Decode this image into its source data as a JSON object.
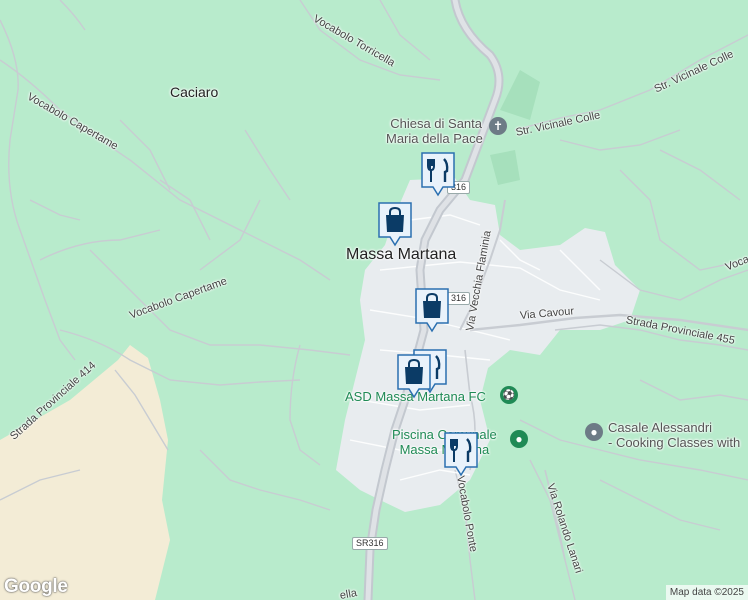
{
  "places": {
    "town": "Massa Martana",
    "hamlet": "Caciaro"
  },
  "roads": {
    "torricella": "Vocabolo Torricella",
    "capertame_1": "Vocabolo Capertame",
    "capertame_2": "Vocabolo Capertame",
    "sp414": "Strada Provinciale 414",
    "vicinale_colle_1": "Str. Vicinale Colle",
    "vicinale_colle_2": "Str. Vicinale Colle",
    "vecchia_flaminia": "Via Vecchia Flaminia",
    "cavour": "Via Cavour",
    "sp455": "Strada Provinciale 455",
    "vocabolo_ponte": "Vocabolo Ponte",
    "rolando_lanari": "Via Rolando Lanari",
    "voca_edge": "Voca",
    "bottom_cut": "ella"
  },
  "badges": {
    "sr316_top": "316",
    "sr316_mid": "316",
    "sr316_bottom": "SR316"
  },
  "pois": {
    "church_line1": "Chiesa di Santa",
    "church_line2": "Maria della Pace",
    "asd": "ASD Massa Martana FC",
    "piscina_line1": "Piscina Comunale",
    "piscina_line2": "Massa Martana",
    "casale_line1": "Casale Alessandri",
    "casale_line2": "- Cooking Classes with"
  },
  "markers": [
    {
      "id": "restaurant-top",
      "icon": "fork-knife-icon"
    },
    {
      "id": "shopping-1",
      "icon": "shopping-bag-icon"
    },
    {
      "id": "shopping-2",
      "icon": "shopping-bag-icon"
    },
    {
      "id": "shopping-3",
      "icon": "shopping-bag-icon"
    },
    {
      "id": "restaurant-bottom",
      "icon": "fork-knife-icon"
    }
  ],
  "branding": {
    "logo": "Google",
    "attribution": "Map data ©2025"
  },
  "colors": {
    "land": "#b8ebcc",
    "urban": "#e8ecef",
    "agri": "#f3ecd6",
    "road": "#c8ccd2",
    "marker_fill": "#0b3b66",
    "marker_bg": "#e9f2fb",
    "poi_gray": "#6d7b86",
    "poi_green": "#1f8a55"
  }
}
